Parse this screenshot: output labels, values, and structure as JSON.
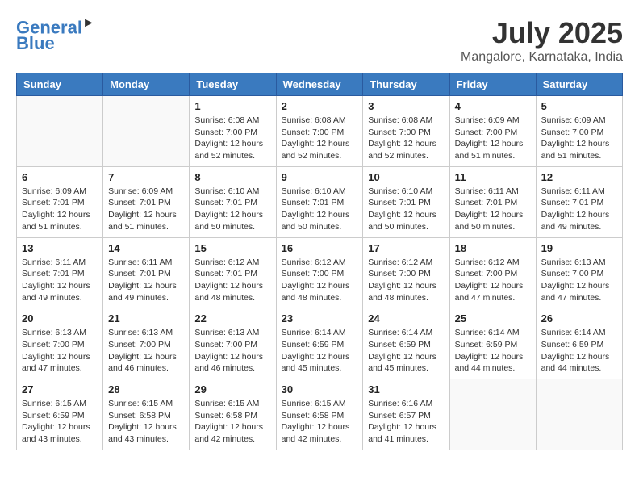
{
  "logo": {
    "general": "General",
    "blue": "Blue"
  },
  "header": {
    "month_year": "July 2025",
    "location": "Mangalore, Karnataka, India"
  },
  "days_of_week": [
    "Sunday",
    "Monday",
    "Tuesday",
    "Wednesday",
    "Thursday",
    "Friday",
    "Saturday"
  ],
  "weeks": [
    [
      {
        "day": "",
        "empty": true
      },
      {
        "day": "",
        "empty": true
      },
      {
        "day": "1",
        "sunrise": "6:08 AM",
        "sunset": "7:00 PM",
        "daylight": "12 hours and 52 minutes."
      },
      {
        "day": "2",
        "sunrise": "6:08 AM",
        "sunset": "7:00 PM",
        "daylight": "12 hours and 52 minutes."
      },
      {
        "day": "3",
        "sunrise": "6:08 AM",
        "sunset": "7:00 PM",
        "daylight": "12 hours and 52 minutes."
      },
      {
        "day": "4",
        "sunrise": "6:09 AM",
        "sunset": "7:00 PM",
        "daylight": "12 hours and 51 minutes."
      },
      {
        "day": "5",
        "sunrise": "6:09 AM",
        "sunset": "7:00 PM",
        "daylight": "12 hours and 51 minutes."
      }
    ],
    [
      {
        "day": "6",
        "sunrise": "6:09 AM",
        "sunset": "7:01 PM",
        "daylight": "12 hours and 51 minutes."
      },
      {
        "day": "7",
        "sunrise": "6:09 AM",
        "sunset": "7:01 PM",
        "daylight": "12 hours and 51 minutes."
      },
      {
        "day": "8",
        "sunrise": "6:10 AM",
        "sunset": "7:01 PM",
        "daylight": "12 hours and 50 minutes."
      },
      {
        "day": "9",
        "sunrise": "6:10 AM",
        "sunset": "7:01 PM",
        "daylight": "12 hours and 50 minutes."
      },
      {
        "day": "10",
        "sunrise": "6:10 AM",
        "sunset": "7:01 PM",
        "daylight": "12 hours and 50 minutes."
      },
      {
        "day": "11",
        "sunrise": "6:11 AM",
        "sunset": "7:01 PM",
        "daylight": "12 hours and 50 minutes."
      },
      {
        "day": "12",
        "sunrise": "6:11 AM",
        "sunset": "7:01 PM",
        "daylight": "12 hours and 49 minutes."
      }
    ],
    [
      {
        "day": "13",
        "sunrise": "6:11 AM",
        "sunset": "7:01 PM",
        "daylight": "12 hours and 49 minutes."
      },
      {
        "day": "14",
        "sunrise": "6:11 AM",
        "sunset": "7:01 PM",
        "daylight": "12 hours and 49 minutes."
      },
      {
        "day": "15",
        "sunrise": "6:12 AM",
        "sunset": "7:01 PM",
        "daylight": "12 hours and 48 minutes."
      },
      {
        "day": "16",
        "sunrise": "6:12 AM",
        "sunset": "7:00 PM",
        "daylight": "12 hours and 48 minutes."
      },
      {
        "day": "17",
        "sunrise": "6:12 AM",
        "sunset": "7:00 PM",
        "daylight": "12 hours and 48 minutes."
      },
      {
        "day": "18",
        "sunrise": "6:12 AM",
        "sunset": "7:00 PM",
        "daylight": "12 hours and 47 minutes."
      },
      {
        "day": "19",
        "sunrise": "6:13 AM",
        "sunset": "7:00 PM",
        "daylight": "12 hours and 47 minutes."
      }
    ],
    [
      {
        "day": "20",
        "sunrise": "6:13 AM",
        "sunset": "7:00 PM",
        "daylight": "12 hours and 47 minutes."
      },
      {
        "day": "21",
        "sunrise": "6:13 AM",
        "sunset": "7:00 PM",
        "daylight": "12 hours and 46 minutes."
      },
      {
        "day": "22",
        "sunrise": "6:13 AM",
        "sunset": "7:00 PM",
        "daylight": "12 hours and 46 minutes."
      },
      {
        "day": "23",
        "sunrise": "6:14 AM",
        "sunset": "6:59 PM",
        "daylight": "12 hours and 45 minutes."
      },
      {
        "day": "24",
        "sunrise": "6:14 AM",
        "sunset": "6:59 PM",
        "daylight": "12 hours and 45 minutes."
      },
      {
        "day": "25",
        "sunrise": "6:14 AM",
        "sunset": "6:59 PM",
        "daylight": "12 hours and 44 minutes."
      },
      {
        "day": "26",
        "sunrise": "6:14 AM",
        "sunset": "6:59 PM",
        "daylight": "12 hours and 44 minutes."
      }
    ],
    [
      {
        "day": "27",
        "sunrise": "6:15 AM",
        "sunset": "6:59 PM",
        "daylight": "12 hours and 43 minutes."
      },
      {
        "day": "28",
        "sunrise": "6:15 AM",
        "sunset": "6:58 PM",
        "daylight": "12 hours and 43 minutes."
      },
      {
        "day": "29",
        "sunrise": "6:15 AM",
        "sunset": "6:58 PM",
        "daylight": "12 hours and 42 minutes."
      },
      {
        "day": "30",
        "sunrise": "6:15 AM",
        "sunset": "6:58 PM",
        "daylight": "12 hours and 42 minutes."
      },
      {
        "day": "31",
        "sunrise": "6:16 AM",
        "sunset": "6:57 PM",
        "daylight": "12 hours and 41 minutes."
      },
      {
        "day": "",
        "empty": true
      },
      {
        "day": "",
        "empty": true
      }
    ]
  ]
}
